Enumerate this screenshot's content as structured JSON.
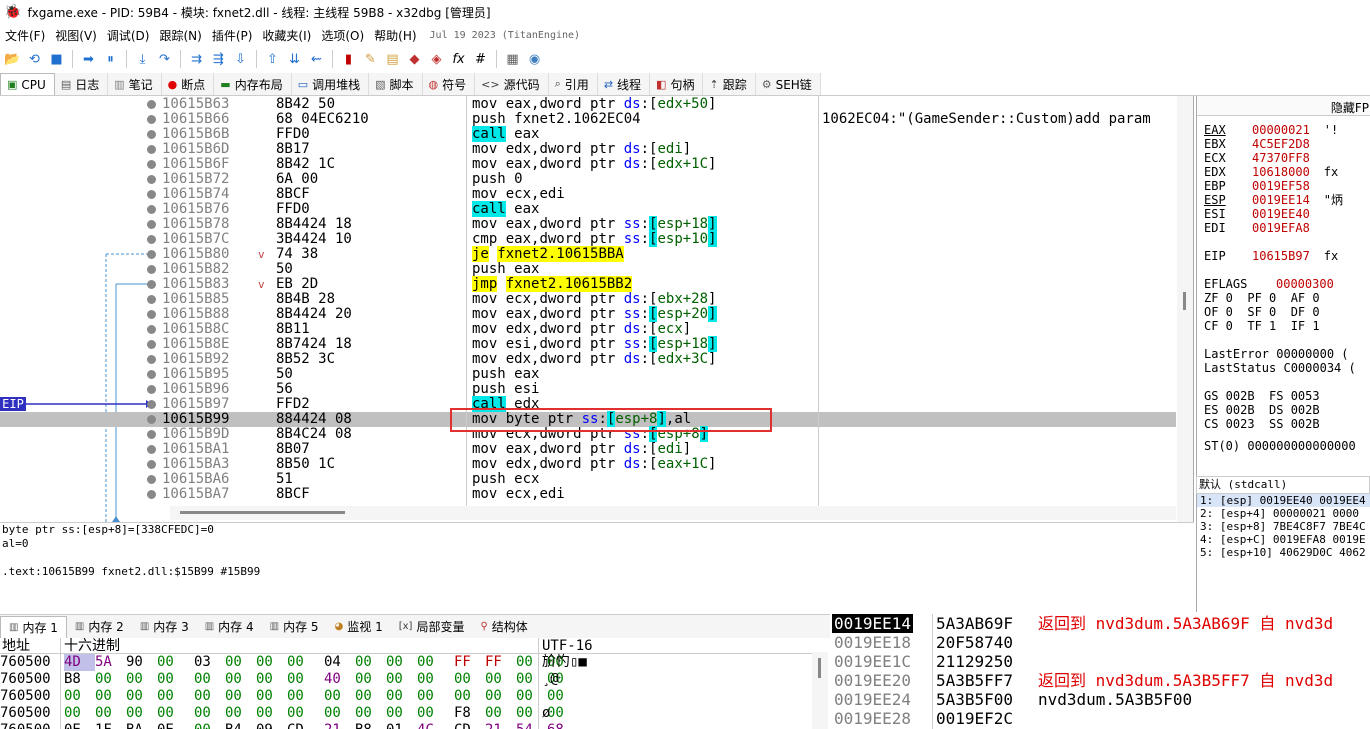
{
  "title_bar": {
    "text": "fxgame.exe - PID: 59B4 - 模块: fxnet2.dll - 线程: 主线程 59B8 - x32dbg [管理员]"
  },
  "menu": {
    "items": [
      "文件(F)",
      "视图(V)",
      "调试(D)",
      "跟踪(N)",
      "插件(P)",
      "收藏夹(I)",
      "选项(O)",
      "帮助(H)"
    ],
    "build_date": "Jul 19 2023 (TitanEngine)"
  },
  "tabs": [
    {
      "label": "CPU",
      "icon": "cpu-icon"
    },
    {
      "label": "日志",
      "icon": "log-icon"
    },
    {
      "label": "笔记",
      "icon": "notes-icon"
    },
    {
      "label": "断点",
      "icon": "breakpoint-icon"
    },
    {
      "label": "内存布局",
      "icon": "memory-map-icon"
    },
    {
      "label": "调用堆栈",
      "icon": "callstack-icon"
    },
    {
      "label": "脚本",
      "icon": "script-icon"
    },
    {
      "label": "符号",
      "icon": "symbols-icon"
    },
    {
      "label": "源代码",
      "icon": "source-icon"
    },
    {
      "label": "引用",
      "icon": "references-icon"
    },
    {
      "label": "线程",
      "icon": "threads-icon"
    },
    {
      "label": "句柄",
      "icon": "handles-icon"
    },
    {
      "label": "跟踪",
      "icon": "trace-icon"
    },
    {
      "label": "SEH链",
      "icon": "seh-icon"
    }
  ],
  "disasm": {
    "eip_label": "EIP",
    "rows": [
      {
        "addr": "10615B63",
        "bytes": "8B42 50",
        "mn": "mov",
        "ops": [
          [
            "",
            "eax,dword ptr "
          ],
          [
            "blue",
            "ds"
          ],
          [
            "",
            ":["
          ],
          [
            "reg",
            "edx+50"
          ],
          [
            "",
            "]"
          ]
        ],
        "cmt": ""
      },
      {
        "addr": "10615B66",
        "bytes": "68 04EC6210",
        "mn": "push",
        "ops": [
          [
            "",
            "fxnet2.1062EC04"
          ]
        ],
        "cmt": "1062EC04:\"(GameSender::Custom)add param"
      },
      {
        "addr": "10615B6B",
        "bytes": "FFD0",
        "mn": "call",
        "hl": "call",
        "ops": [
          [
            "",
            "eax"
          ]
        ],
        "cmt": ""
      },
      {
        "addr": "10615B6D",
        "bytes": "8B17",
        "mn": "mov",
        "ops": [
          [
            "",
            "edx,dword ptr "
          ],
          [
            "blue",
            "ds"
          ],
          [
            "",
            ":["
          ],
          [
            "reg",
            "edi"
          ],
          [
            "",
            "]"
          ]
        ],
        "cmt": ""
      },
      {
        "addr": "10615B6F",
        "bytes": "8B42 1C",
        "mn": "mov",
        "ops": [
          [
            "",
            "eax,dword ptr "
          ],
          [
            "blue",
            "ds"
          ],
          [
            "",
            ":["
          ],
          [
            "reg",
            "edx+1C"
          ],
          [
            "",
            "]"
          ]
        ],
        "cmt": ""
      },
      {
        "addr": "10615B72",
        "bytes": "6A 00",
        "mn": "push",
        "ops": [
          [
            "",
            "0"
          ]
        ],
        "cmt": ""
      },
      {
        "addr": "10615B74",
        "bytes": "8BCF",
        "mn": "mov",
        "ops": [
          [
            "",
            "ecx,edi"
          ]
        ],
        "cmt": ""
      },
      {
        "addr": "10615B76",
        "bytes": "FFD0",
        "mn": "call",
        "hl": "call",
        "ops": [
          [
            "",
            "eax"
          ]
        ],
        "cmt": ""
      },
      {
        "addr": "10615B78",
        "bytes": "8B4424 18",
        "mn": "mov",
        "ops": [
          [
            "",
            "eax,dword ptr "
          ],
          [
            "blue",
            "ss"
          ],
          [
            "",
            ":"
          ],
          [
            "brk",
            "["
          ],
          [
            "reg",
            "esp+18"
          ],
          [
            "brk",
            "]"
          ]
        ],
        "cmt": ""
      },
      {
        "addr": "10615B7C",
        "bytes": "3B4424 10",
        "mn": "cmp",
        "ops": [
          [
            "",
            "eax,dword ptr "
          ],
          [
            "blue",
            "ss"
          ],
          [
            "",
            ":"
          ],
          [
            "brk",
            "["
          ],
          [
            "reg",
            "esp+10"
          ],
          [
            "brk",
            "]"
          ]
        ],
        "cmt": ""
      },
      {
        "addr": "10615B80",
        "arr": "v",
        "bytes": "74 38",
        "mn": "je",
        "hl": "jmp",
        "ops": [
          [
            "jt",
            "fxnet2.10615BBA"
          ]
        ],
        "cmt": ""
      },
      {
        "addr": "10615B82",
        "bytes": "50",
        "mn": "push",
        "ops": [
          [
            "",
            "eax"
          ]
        ],
        "cmt": ""
      },
      {
        "addr": "10615B83",
        "arr": "v",
        "bytes": "EB 2D",
        "mn": "jmp",
        "hl": "jmp",
        "ops": [
          [
            "jt",
            "fxnet2.10615BB2"
          ]
        ],
        "cmt": ""
      },
      {
        "addr": "10615B85",
        "bytes": "8B4B 28",
        "mn": "mov",
        "ops": [
          [
            "",
            "ecx,dword ptr "
          ],
          [
            "blue",
            "ds"
          ],
          [
            "",
            ":["
          ],
          [
            "reg",
            "ebx+28"
          ],
          [
            "",
            "]"
          ]
        ],
        "cmt": ""
      },
      {
        "addr": "10615B88",
        "bytes": "8B4424 20",
        "mn": "mov",
        "ops": [
          [
            "",
            "eax,dword ptr "
          ],
          [
            "blue",
            "ss"
          ],
          [
            "",
            ":"
          ],
          [
            "brk",
            "["
          ],
          [
            "reg",
            "esp+20"
          ],
          [
            "brk",
            "]"
          ]
        ],
        "cmt": ""
      },
      {
        "addr": "10615B8C",
        "bytes": "8B11",
        "mn": "mov",
        "ops": [
          [
            "",
            "edx,dword ptr "
          ],
          [
            "blue",
            "ds"
          ],
          [
            "",
            ":["
          ],
          [
            "reg",
            "ecx"
          ],
          [
            "",
            "]"
          ]
        ],
        "cmt": ""
      },
      {
        "addr": "10615B8E",
        "bytes": "8B7424 18",
        "mn": "mov",
        "ops": [
          [
            "",
            "esi,dword ptr "
          ],
          [
            "blue",
            "ss"
          ],
          [
            "",
            ":"
          ],
          [
            "brk",
            "["
          ],
          [
            "reg",
            "esp+18"
          ],
          [
            "brk",
            "]"
          ]
        ],
        "cmt": ""
      },
      {
        "addr": "10615B92",
        "bytes": "8B52 3C",
        "mn": "mov",
        "ops": [
          [
            "",
            "edx,dword ptr "
          ],
          [
            "blue",
            "ds"
          ],
          [
            "",
            ":["
          ],
          [
            "reg",
            "edx+3C"
          ],
          [
            "",
            "]"
          ]
        ],
        "cmt": ""
      },
      {
        "addr": "10615B95",
        "bytes": "50",
        "mn": "push",
        "ops": [
          [
            "",
            "eax"
          ]
        ],
        "cmt": ""
      },
      {
        "addr": "10615B96",
        "bytes": "56",
        "mn": "push",
        "ops": [
          [
            "",
            "esi"
          ]
        ],
        "cmt": ""
      },
      {
        "addr": "10615B97",
        "bytes": "FFD2",
        "mn": "call",
        "hl": "call",
        "ops": [
          [
            "",
            "edx"
          ]
        ],
        "cmt": ""
      },
      {
        "addr": "10615B99",
        "bytes": "884424 08",
        "mn": "mov",
        "sel": true,
        "ops": [
          [
            "",
            "byte ptr "
          ],
          [
            "blue",
            "ss"
          ],
          [
            "",
            ":"
          ],
          [
            "brk",
            "["
          ],
          [
            "reg",
            "esp+8"
          ],
          [
            "brk",
            "]"
          ],
          [
            "",
            ",al"
          ]
        ],
        "cmt": ""
      },
      {
        "addr": "10615B9D",
        "bytes": "8B4C24 08",
        "mn": "mov",
        "ops": [
          [
            "",
            "ecx,dword ptr "
          ],
          [
            "blue",
            "ss"
          ],
          [
            "",
            ":"
          ],
          [
            "brk",
            "["
          ],
          [
            "reg",
            "esp+8"
          ],
          [
            "brk",
            "]"
          ]
        ],
        "cmt": ""
      },
      {
        "addr": "10615BA1",
        "bytes": "8B07",
        "mn": "mov",
        "ops": [
          [
            "",
            "eax,dword ptr "
          ],
          [
            "blue",
            "ds"
          ],
          [
            "",
            ":["
          ],
          [
            "reg",
            "edi"
          ],
          [
            "",
            "]"
          ]
        ],
        "cmt": ""
      },
      {
        "addr": "10615BA3",
        "bytes": "8B50 1C",
        "mn": "mov",
        "ops": [
          [
            "",
            "edx,dword ptr "
          ],
          [
            "blue",
            "ds"
          ],
          [
            "",
            ":["
          ],
          [
            "reg",
            "eax+1C"
          ],
          [
            "",
            "]"
          ]
        ],
        "cmt": ""
      },
      {
        "addr": "10615BA6",
        "bytes": "51",
        "mn": "push",
        "ops": [
          [
            "",
            "ecx"
          ]
        ],
        "cmt": ""
      },
      {
        "addr": "10615BA7",
        "bytes": "8BCF",
        "mn": "mov",
        "ops": [
          [
            "",
            "ecx,edi"
          ]
        ],
        "cmt": ""
      }
    ]
  },
  "info": {
    "line1": "byte ptr ss:[esp+8]=[338CFEDC]=0",
    "line2": "al=0",
    "line3": ".text:10615B99 fxnet2.dll:$15B99 #15B99"
  },
  "registers": {
    "header": "隐藏FP",
    "gpr": [
      {
        "name": "EAX",
        "value": "00000021",
        "extra": "'!",
        "ul": true
      },
      {
        "name": "EBX",
        "value": "4C5EF2D8",
        "extra": ""
      },
      {
        "name": "ECX",
        "value": "47370FF8",
        "extra": ""
      },
      {
        "name": "EDX",
        "value": "10618000",
        "extra": "fx"
      },
      {
        "name": "EBP",
        "value": "0019EF58",
        "extra": ""
      },
      {
        "name": "ESP",
        "value": "0019EE14",
        "extra": "\"炳",
        "ul": true
      },
      {
        "name": "ESI",
        "value": "0019EE40",
        "extra": ""
      },
      {
        "name": "EDI",
        "value": "0019EFA8",
        "extra": ""
      }
    ],
    "eip": {
      "name": "EIP",
      "value": "10615B97",
      "extra": "fx"
    },
    "eflags": {
      "name": "EFLAGS",
      "value": "00000300"
    },
    "flags": [
      "ZF 0  PF 0  AF 0",
      "OF 0  SF 0  DF 0",
      "CF 0  TF 1  IF 1"
    ],
    "last_error": "LastError  00000000 (",
    "last_status": "LastStatus C0000034 (",
    "segs": [
      "GS 002B  FS 0053",
      "ES 002B  DS 002B",
      "CS 0023  SS 002B"
    ],
    "st0": "ST(0) 000000000000000"
  },
  "callconv": {
    "header": "默认 (stdcall)",
    "rows": [
      "1: [esp] 0019EE40 0019EE4",
      "2: [esp+4] 00000021 0000",
      "3: [esp+8] 7BE4C8F7 7BE4C",
      "4: [esp+C] 0019EFA8 0019E",
      "5: [esp+10] 40629D0C 4062"
    ]
  },
  "bottom_tabs": [
    {
      "label": "内存 1",
      "icon": "memory-icon"
    },
    {
      "label": "内存 2",
      "icon": "memory-icon"
    },
    {
      "label": "内存 3",
      "icon": "memory-icon"
    },
    {
      "label": "内存 4",
      "icon": "memory-icon"
    },
    {
      "label": "内存 5",
      "icon": "memory-icon"
    },
    {
      "label": "监视 1",
      "icon": "watch-icon"
    },
    {
      "label": "局部变量",
      "icon": "locals-icon"
    },
    {
      "label": "结构体",
      "icon": "struct-icon"
    }
  ],
  "dump": {
    "col_addr": "地址",
    "col_hex": "十六进制",
    "col_text": "UTF-16",
    "rows": [
      {
        "addr": "760500",
        "hex": [
          [
            "4D",
            "mz"
          ],
          [
            "5A",
            "mz2"
          ],
          [
            "90",
            ""
          ],
          [
            "00",
            ""
          ],
          [
            "03",
            ""
          ],
          [
            "00",
            ""
          ],
          [
            "00",
            ""
          ],
          [
            "00",
            ""
          ],
          [
            "04",
            ""
          ],
          [
            "00",
            ""
          ],
          [
            "00",
            ""
          ],
          [
            "00",
            ""
          ],
          [
            "FF",
            "r"
          ],
          [
            "FF",
            "r"
          ],
          [
            "00",
            ""
          ],
          [
            "00",
            ""
          ]
        ],
        "text": "斺㣿▯■"
      },
      {
        "addr": "760500",
        "hex": [
          [
            "B8",
            ""
          ],
          [
            "00",
            ""
          ],
          [
            "00",
            ""
          ],
          [
            "00",
            ""
          ],
          [
            "00",
            ""
          ],
          [
            "00",
            ""
          ],
          [
            "00",
            ""
          ],
          [
            "00",
            ""
          ],
          [
            "40",
            "p"
          ],
          [
            "00",
            ""
          ],
          [
            "00",
            ""
          ],
          [
            "00",
            ""
          ],
          [
            "00",
            ""
          ],
          [
            "00",
            ""
          ],
          [
            "00",
            ""
          ],
          [
            "00",
            ""
          ]
        ],
        "text": "¸@"
      },
      {
        "addr": "760500",
        "hex": [
          [
            "00",
            ""
          ],
          [
            "00",
            ""
          ],
          [
            "00",
            ""
          ],
          [
            "00",
            ""
          ],
          [
            "00",
            ""
          ],
          [
            "00",
            ""
          ],
          [
            "00",
            ""
          ],
          [
            "00",
            ""
          ],
          [
            "00",
            ""
          ],
          [
            "00",
            ""
          ],
          [
            "00",
            ""
          ],
          [
            "00",
            ""
          ],
          [
            "00",
            ""
          ],
          [
            "00",
            ""
          ],
          [
            "00",
            ""
          ],
          [
            "00",
            ""
          ]
        ],
        "text": ""
      },
      {
        "addr": "760500",
        "hex": [
          [
            "00",
            ""
          ],
          [
            "00",
            ""
          ],
          [
            "00",
            ""
          ],
          [
            "00",
            ""
          ],
          [
            "00",
            ""
          ],
          [
            "00",
            ""
          ],
          [
            "00",
            ""
          ],
          [
            "00",
            ""
          ],
          [
            "00",
            ""
          ],
          [
            "00",
            ""
          ],
          [
            "00",
            ""
          ],
          [
            "00",
            ""
          ],
          [
            "F8",
            ""
          ],
          [
            "00",
            ""
          ],
          [
            "00",
            ""
          ],
          [
            "00",
            ""
          ]
        ],
        "text": "ø"
      },
      {
        "addr": "760500",
        "hex": [
          [
            "0E",
            ""
          ],
          [
            "1F",
            ""
          ],
          [
            "BA",
            ""
          ],
          [
            "0E",
            ""
          ],
          [
            "00",
            ""
          ],
          [
            "B4",
            ""
          ],
          [
            "09",
            ""
          ],
          [
            "CD",
            ""
          ],
          [
            "21",
            "p"
          ],
          [
            "B8",
            ""
          ],
          [
            "01",
            ""
          ],
          [
            "4C",
            "p"
          ],
          [
            "CD",
            ""
          ],
          [
            "21",
            "p"
          ],
          [
            "54",
            "p"
          ],
          [
            "68",
            "p"
          ]
        ],
        "text": "  ..."
      }
    ]
  },
  "stack": {
    "rows": [
      {
        "addr": "0019EE14",
        "val": "5A3AB69F",
        "cmt": "返回到 nvd3dum.5A3AB69F 自 nvd3d",
        "sel": true,
        "red": true
      },
      {
        "addr": "0019EE18",
        "val": "20F58740",
        "cmt": ""
      },
      {
        "addr": "0019EE1C",
        "val": "21129250",
        "cmt": ""
      },
      {
        "addr": "0019EE20",
        "val": "5A3B5FF7",
        "cmt": "返回到 nvd3dum.5A3B5FF7 自 nvd3d",
        "red": true
      },
      {
        "addr": "0019EE24",
        "val": "5A3B5F00",
        "cmt": "nvd3dum.5A3B5F00"
      },
      {
        "addr": "0019EE28",
        "val": "0019EF2C",
        "cmt": ""
      }
    ]
  }
}
